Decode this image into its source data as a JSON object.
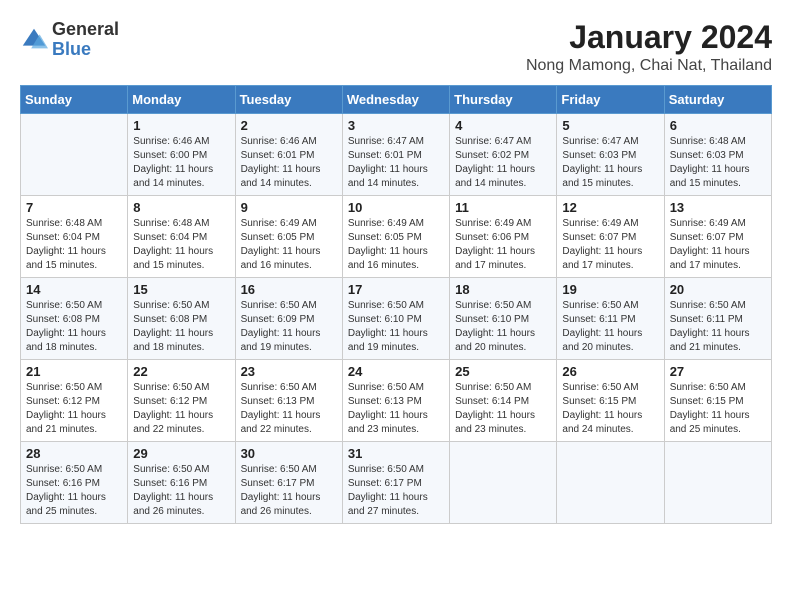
{
  "header": {
    "logo_general": "General",
    "logo_blue": "Blue",
    "month_title": "January 2024",
    "location": "Nong Mamong, Chai Nat, Thailand"
  },
  "weekdays": [
    "Sunday",
    "Monday",
    "Tuesday",
    "Wednesday",
    "Thursday",
    "Friday",
    "Saturday"
  ],
  "weeks": [
    [
      {
        "day": "",
        "sunrise": "",
        "sunset": "",
        "daylight": ""
      },
      {
        "day": "1",
        "sunrise": "6:46 AM",
        "sunset": "6:00 PM",
        "daylight": "11 hours and 14 minutes."
      },
      {
        "day": "2",
        "sunrise": "6:46 AM",
        "sunset": "6:01 PM",
        "daylight": "11 hours and 14 minutes."
      },
      {
        "day": "3",
        "sunrise": "6:47 AM",
        "sunset": "6:01 PM",
        "daylight": "11 hours and 14 minutes."
      },
      {
        "day": "4",
        "sunrise": "6:47 AM",
        "sunset": "6:02 PM",
        "daylight": "11 hours and 14 minutes."
      },
      {
        "day": "5",
        "sunrise": "6:47 AM",
        "sunset": "6:03 PM",
        "daylight": "11 hours and 15 minutes."
      },
      {
        "day": "6",
        "sunrise": "6:48 AM",
        "sunset": "6:03 PM",
        "daylight": "11 hours and 15 minutes."
      }
    ],
    [
      {
        "day": "7",
        "sunrise": "6:48 AM",
        "sunset": "6:04 PM",
        "daylight": "11 hours and 15 minutes."
      },
      {
        "day": "8",
        "sunrise": "6:48 AM",
        "sunset": "6:04 PM",
        "daylight": "11 hours and 15 minutes."
      },
      {
        "day": "9",
        "sunrise": "6:49 AM",
        "sunset": "6:05 PM",
        "daylight": "11 hours and 16 minutes."
      },
      {
        "day": "10",
        "sunrise": "6:49 AM",
        "sunset": "6:05 PM",
        "daylight": "11 hours and 16 minutes."
      },
      {
        "day": "11",
        "sunrise": "6:49 AM",
        "sunset": "6:06 PM",
        "daylight": "11 hours and 17 minutes."
      },
      {
        "day": "12",
        "sunrise": "6:49 AM",
        "sunset": "6:07 PM",
        "daylight": "11 hours and 17 minutes."
      },
      {
        "day": "13",
        "sunrise": "6:49 AM",
        "sunset": "6:07 PM",
        "daylight": "11 hours and 17 minutes."
      }
    ],
    [
      {
        "day": "14",
        "sunrise": "6:50 AM",
        "sunset": "6:08 PM",
        "daylight": "11 hours and 18 minutes."
      },
      {
        "day": "15",
        "sunrise": "6:50 AM",
        "sunset": "6:08 PM",
        "daylight": "11 hours and 18 minutes."
      },
      {
        "day": "16",
        "sunrise": "6:50 AM",
        "sunset": "6:09 PM",
        "daylight": "11 hours and 19 minutes."
      },
      {
        "day": "17",
        "sunrise": "6:50 AM",
        "sunset": "6:10 PM",
        "daylight": "11 hours and 19 minutes."
      },
      {
        "day": "18",
        "sunrise": "6:50 AM",
        "sunset": "6:10 PM",
        "daylight": "11 hours and 20 minutes."
      },
      {
        "day": "19",
        "sunrise": "6:50 AM",
        "sunset": "6:11 PM",
        "daylight": "11 hours and 20 minutes."
      },
      {
        "day": "20",
        "sunrise": "6:50 AM",
        "sunset": "6:11 PM",
        "daylight": "11 hours and 21 minutes."
      }
    ],
    [
      {
        "day": "21",
        "sunrise": "6:50 AM",
        "sunset": "6:12 PM",
        "daylight": "11 hours and 21 minutes."
      },
      {
        "day": "22",
        "sunrise": "6:50 AM",
        "sunset": "6:12 PM",
        "daylight": "11 hours and 22 minutes."
      },
      {
        "day": "23",
        "sunrise": "6:50 AM",
        "sunset": "6:13 PM",
        "daylight": "11 hours and 22 minutes."
      },
      {
        "day": "24",
        "sunrise": "6:50 AM",
        "sunset": "6:13 PM",
        "daylight": "11 hours and 23 minutes."
      },
      {
        "day": "25",
        "sunrise": "6:50 AM",
        "sunset": "6:14 PM",
        "daylight": "11 hours and 23 minutes."
      },
      {
        "day": "26",
        "sunrise": "6:50 AM",
        "sunset": "6:15 PM",
        "daylight": "11 hours and 24 minutes."
      },
      {
        "day": "27",
        "sunrise": "6:50 AM",
        "sunset": "6:15 PM",
        "daylight": "11 hours and 25 minutes."
      }
    ],
    [
      {
        "day": "28",
        "sunrise": "6:50 AM",
        "sunset": "6:16 PM",
        "daylight": "11 hours and 25 minutes."
      },
      {
        "day": "29",
        "sunrise": "6:50 AM",
        "sunset": "6:16 PM",
        "daylight": "11 hours and 26 minutes."
      },
      {
        "day": "30",
        "sunrise": "6:50 AM",
        "sunset": "6:17 PM",
        "daylight": "11 hours and 26 minutes."
      },
      {
        "day": "31",
        "sunrise": "6:50 AM",
        "sunset": "6:17 PM",
        "daylight": "11 hours and 27 minutes."
      },
      {
        "day": "",
        "sunrise": "",
        "sunset": "",
        "daylight": ""
      },
      {
        "day": "",
        "sunrise": "",
        "sunset": "",
        "daylight": ""
      },
      {
        "day": "",
        "sunrise": "",
        "sunset": "",
        "daylight": ""
      }
    ]
  ],
  "labels": {
    "sunrise_prefix": "Sunrise: ",
    "sunset_prefix": "Sunset: ",
    "daylight_prefix": "Daylight: "
  }
}
